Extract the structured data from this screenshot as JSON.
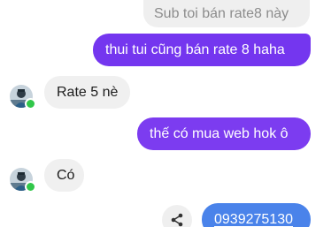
{
  "messages": {
    "quoted_reply": "Sub toi bán rate8 này",
    "outgoing_1": "thui tui cũng bán rate 8 haha",
    "incoming_1": "Rate 5 nè",
    "outgoing_2": "thế có mua web hok ô",
    "incoming_2": "Có",
    "outgoing_phone": "0939275130"
  },
  "colors": {
    "outgoing_bubble": "#7c3cef",
    "incoming_bubble": "#f0f0f0",
    "phone_bubble": "#4a83ea",
    "online_dot": "#31c74a"
  },
  "icons": {
    "avatar": "profile-photo",
    "status": "online-dot",
    "share": "share-icon"
  }
}
